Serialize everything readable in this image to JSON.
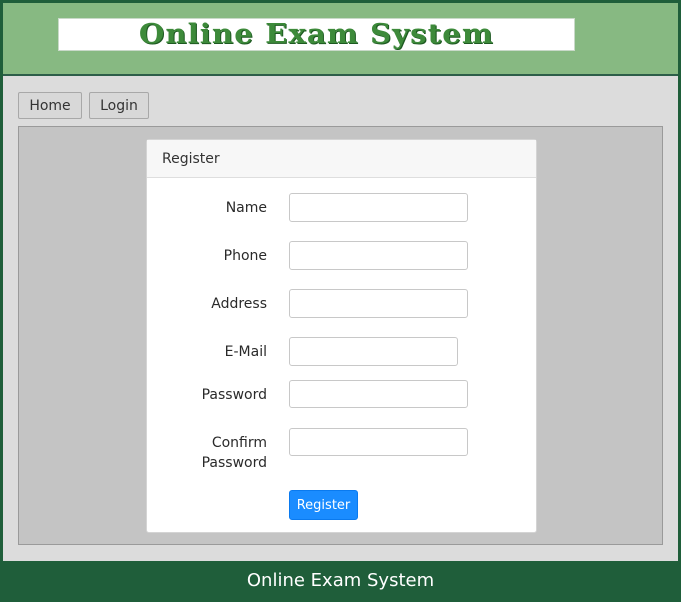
{
  "header": {
    "logo_text": "Online Exam System"
  },
  "nav": {
    "home_label": "Home",
    "login_label": "Login"
  },
  "register_card": {
    "title": "Register",
    "fields": [
      {
        "label": "Name",
        "value": "",
        "placeholder": ""
      },
      {
        "label": "Phone",
        "value": "",
        "placeholder": ""
      },
      {
        "label": "Address",
        "value": "",
        "placeholder": ""
      },
      {
        "label": "E-Mail",
        "value": "",
        "placeholder": ""
      },
      {
        "label": "Password",
        "value": "",
        "placeholder": ""
      },
      {
        "label": "Confirm Password",
        "value": "",
        "placeholder": ""
      }
    ],
    "submit_label": "Register"
  },
  "footer": {
    "text": "Online Exam System"
  },
  "colors": {
    "header_bg": "#87b982",
    "footer_bg": "#1f5e3a",
    "primary_button": "#1a8cff",
    "logo_text": "#3d8a3a"
  }
}
